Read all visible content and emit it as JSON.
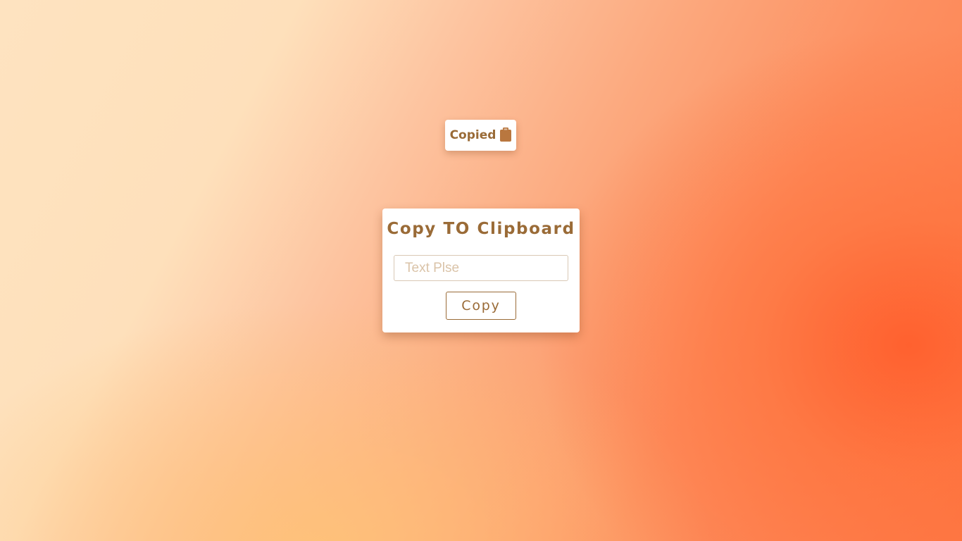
{
  "toast": {
    "label": "Copied",
    "icon": "clipboard-icon"
  },
  "card": {
    "title": "Copy TO Clipboard",
    "input": {
      "value": "",
      "placeholder": "Text Plse"
    },
    "button_label": "Copy"
  },
  "colors": {
    "accent": "#9a6b37",
    "clipboard_icon": "#b9773f",
    "input_border": "#d9c8b5",
    "placeholder": "#dac3a8",
    "background_light": "#fee3c0",
    "background_dark": "#ff6a36"
  }
}
